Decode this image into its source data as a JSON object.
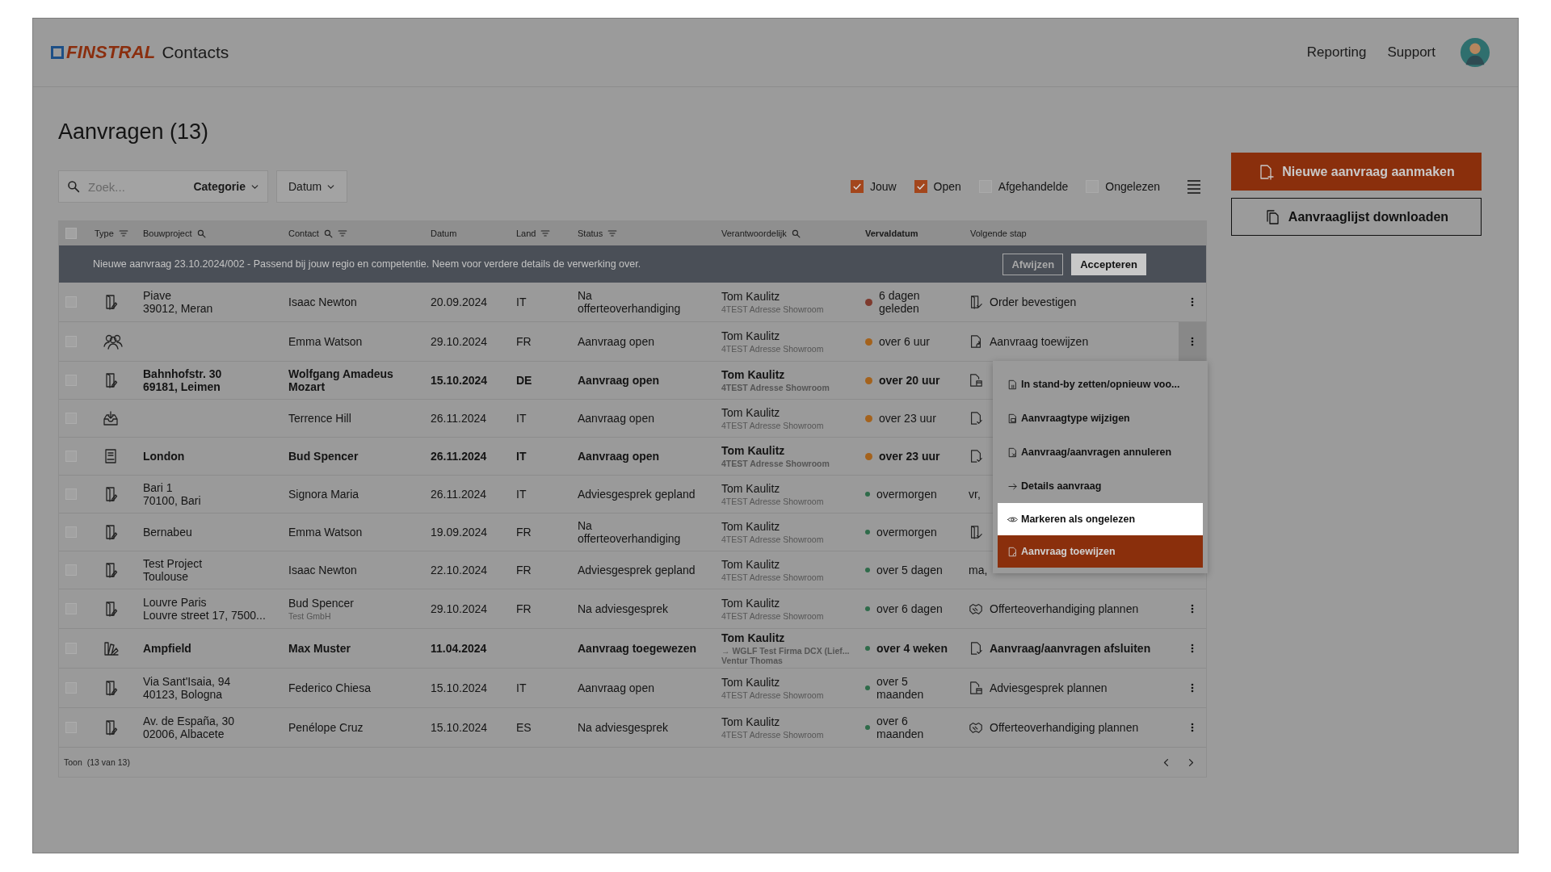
{
  "header": {
    "brand": "FINSTRAL",
    "app": "Contacts",
    "nav": [
      "Reporting",
      "Support"
    ]
  },
  "title": "Aanvragen (13)",
  "toolbar": {
    "search": {
      "placeholder": "Zoek..."
    },
    "category": "Categorie",
    "date": "Datum",
    "filters": [
      {
        "label": "Jouw",
        "checked": true
      },
      {
        "label": "Open",
        "checked": true
      },
      {
        "label": "Afgehandelde",
        "checked": false
      },
      {
        "label": "Ongelezen",
        "checked": false
      }
    ]
  },
  "actions": [
    {
      "label": "Nieuwe aanvraag aanmaken",
      "kind": "primary"
    },
    {
      "label": "Aanvraaglijst downloaden",
      "kind": "secondary"
    }
  ],
  "table": {
    "select_all": {
      "checked": false
    },
    "columns": [
      {
        "label": "Type",
        "search": false,
        "filter": true,
        "sorted": false
      },
      {
        "label": "Bouwproject",
        "search": true,
        "filter": false,
        "sorted": false
      },
      {
        "label": "Contact",
        "search": true,
        "filter": true,
        "sorted": false
      },
      {
        "label": "Datum",
        "search": false,
        "filter": false,
        "sorted": false
      },
      {
        "label": "Land",
        "search": false,
        "filter": true,
        "sorted": false
      },
      {
        "label": "Status",
        "search": false,
        "filter": true,
        "sorted": false
      },
      {
        "label": "Verantwoordelijk",
        "search": true,
        "filter": false,
        "sorted": false
      },
      {
        "label": "Vervaldatum",
        "search": false,
        "filter": false,
        "sorted": true
      },
      {
        "label": "Volgende stap",
        "search": false,
        "filter": false,
        "sorted": false
      }
    ],
    "banner": {
      "text": "Nieuwe aanvraag 23.10.2024/002 - Passend bij jouw regio en competentie. Neem voor verdere details de verwerking over.",
      "buttons": [
        {
          "label": "Afwijzen",
          "kind": "outline"
        },
        {
          "label": "Accepteren",
          "kind": "solid"
        }
      ]
    },
    "rows": [
      {
        "kind": "door",
        "checked": false,
        "unread": false,
        "project": "Piave\n39012, Meran",
        "contact": "Isaac Newton",
        "date": "20.09.2024",
        "land": "IT",
        "status": "Na\nofferteoverhandiging",
        "responsible": "Tom Kaulitz",
        "location": "4TEST Adresse Showroom",
        "due": "6 dagen\ngeleden",
        "color": "#7e3a2e",
        "next": {
          "kind": "door-check",
          "text": "Order bevestigen"
        },
        "menu_open": false
      },
      {
        "kind": "people",
        "checked": false,
        "unread": false,
        "contact": "Emma Watson",
        "date": "29.10.2024",
        "land": "FR",
        "status": "Aanvraag open",
        "responsible": "Tom Kaulitz",
        "location": "4TEST Adresse Showroom",
        "due": "over 6 uur",
        "color": "#a4621c",
        "next": {
          "kind": "doc-assign",
          "text": "Aanvraag toewijzen"
        },
        "menu_open": true
      },
      {
        "kind": "door",
        "checked": false,
        "unread": true,
        "project": "Bahnhofstr. 30\n69181, Leimen",
        "contact": "Wolfgang Amadeus\nMozart",
        "date": "15.10.2024",
        "land": "DE",
        "status": "Aanvraag open",
        "responsible": "Tom Kaulitz",
        "location": "4TEST Adresse Showroom",
        "due": "over 20 uur",
        "color": "#a4621c",
        "next": {
          "kind": "doc-calendar"
        }
      },
      {
        "kind": "inbox",
        "checked": false,
        "unread": false,
        "contact": "Terrence Hill",
        "date": "26.11.2024",
        "land": "IT",
        "status": "Aanvraag open",
        "responsible": "Tom Kaulitz",
        "location": "4TEST Adresse Showroom",
        "due": "over 23 uur",
        "color": "#a4621c",
        "next": {
          "kind": "doc-check"
        }
      },
      {
        "kind": "dwg",
        "checked": false,
        "unread": true,
        "project": "London",
        "contact": "Bud Spencer",
        "date": "26.11.2024",
        "land": "IT",
        "status": "Aanvraag open",
        "responsible": "Tom Kaulitz",
        "location": "4TEST Adresse Showroom",
        "due": "over 23 uur",
        "color": "#a4621c",
        "next": {
          "kind": "doc-check"
        }
      },
      {
        "kind": "door",
        "checked": false,
        "unread": false,
        "project": "Bari 1\n70100, Bari",
        "contact": "Signora Maria",
        "date": "26.11.2024",
        "land": "IT",
        "status": "Adviesgesprek gepland",
        "responsible": "Tom Kaulitz",
        "location": "4TEST Adresse Showroom",
        "due": "overmorgen",
        "color": "#2f6b4a",
        "next": {
          "kind": "none",
          "text": "vr,"
        }
      },
      {
        "kind": "door",
        "checked": false,
        "unread": false,
        "project": "Bernabeu",
        "contact": "Emma Watson",
        "date": "19.09.2024",
        "land": "FR",
        "status": "Na\nofferteoverhandiging",
        "responsible": "Tom Kaulitz",
        "location": "4TEST Adresse Showroom",
        "due": "overmorgen",
        "color": "#2f6b4a",
        "next": {
          "kind": "door-check"
        }
      },
      {
        "kind": "door",
        "checked": false,
        "unread": false,
        "project": "Test Project\nToulouse",
        "contact": "Isaac Newton",
        "date": "22.10.2024",
        "land": "FR",
        "status": "Adviesgesprek gepland",
        "responsible": "Tom Kaulitz",
        "location": "4TEST Adresse Showroom",
        "due": "over 5 dagen",
        "color": "#2f6b4a",
        "next": {
          "kind": "none",
          "text": "ma,"
        }
      },
      {
        "kind": "door",
        "checked": false,
        "unread": false,
        "project": "Louvre Paris\nLouvre street 17, 7500...",
        "contact": "Bud Spencer",
        "company": "Test GmbH",
        "date": "29.10.2024",
        "land": "FR",
        "status": "Na adviesgesprek",
        "responsible": "Tom Kaulitz",
        "location": "4TEST Adresse Showroom",
        "due": "over 6 dagen",
        "color": "#2f6b4a",
        "next": {
          "kind": "handshake",
          "text": "Offerteoverhandiging plannen"
        },
        "menu_open": false
      },
      {
        "kind": "swatch",
        "checked": false,
        "unread": true,
        "project": "Ampfield",
        "contact": "Max Muster",
        "date": "11.04.2024",
        "status": "Aanvraag toegewezen",
        "responsible": "Tom Kaulitz",
        "location": "→ WGLF Test Firma DCX (Lief...\nVentur Thomas",
        "due": "over 4 weken",
        "color": "#2f6b4a",
        "next": {
          "kind": "doc-check",
          "text": "Aanvraag/aanvragen afsluiten"
        },
        "menu_open": false
      },
      {
        "kind": "door",
        "checked": false,
        "unread": false,
        "project": "Via Sant'Isaia, 94\n40123, Bologna",
        "contact": "Federico Chiesa",
        "date": "15.10.2024",
        "land": "IT",
        "status": "Aanvraag open",
        "responsible": "Tom Kaulitz",
        "location": "4TEST Adresse Showroom",
        "due": "over 5\nmaanden",
        "color": "#2f6b4a",
        "next": {
          "kind": "doc-calendar",
          "text": "Adviesgesprek plannen"
        },
        "menu_open": false
      },
      {
        "kind": "door",
        "checked": false,
        "unread": false,
        "project": "Av. de España, 30\n02006, Albacete",
        "contact": "Penélope Cruz",
        "date": "15.10.2024",
        "land": "ES",
        "status": "Na adviesgesprek",
        "responsible": "Tom Kaulitz",
        "location": "4TEST Adresse Showroom",
        "due": "over 6\nmaanden",
        "color": "#2f6b4a",
        "next": {
          "kind": "handshake",
          "text": "Offerteoverhandiging plannen"
        },
        "menu_open": false
      }
    ],
    "footer": {
      "label": "Toon",
      "count": "(13 van 13)"
    }
  },
  "context_menu": [
    {
      "label": "In stand-by zetten/opnieuw voo...",
      "kind": "plain"
    },
    {
      "label": "Aanvraagtype wijzigen",
      "kind": "plain"
    },
    {
      "label": "Aanvraag/aanvragen annuleren",
      "kind": "plain"
    },
    {
      "label": "Details aanvraag",
      "kind": "plain"
    },
    {
      "label": "Markeren als ongelezen",
      "kind": "hover"
    },
    {
      "label": "Aanvraag toewijzen",
      "kind": "primary"
    }
  ]
}
